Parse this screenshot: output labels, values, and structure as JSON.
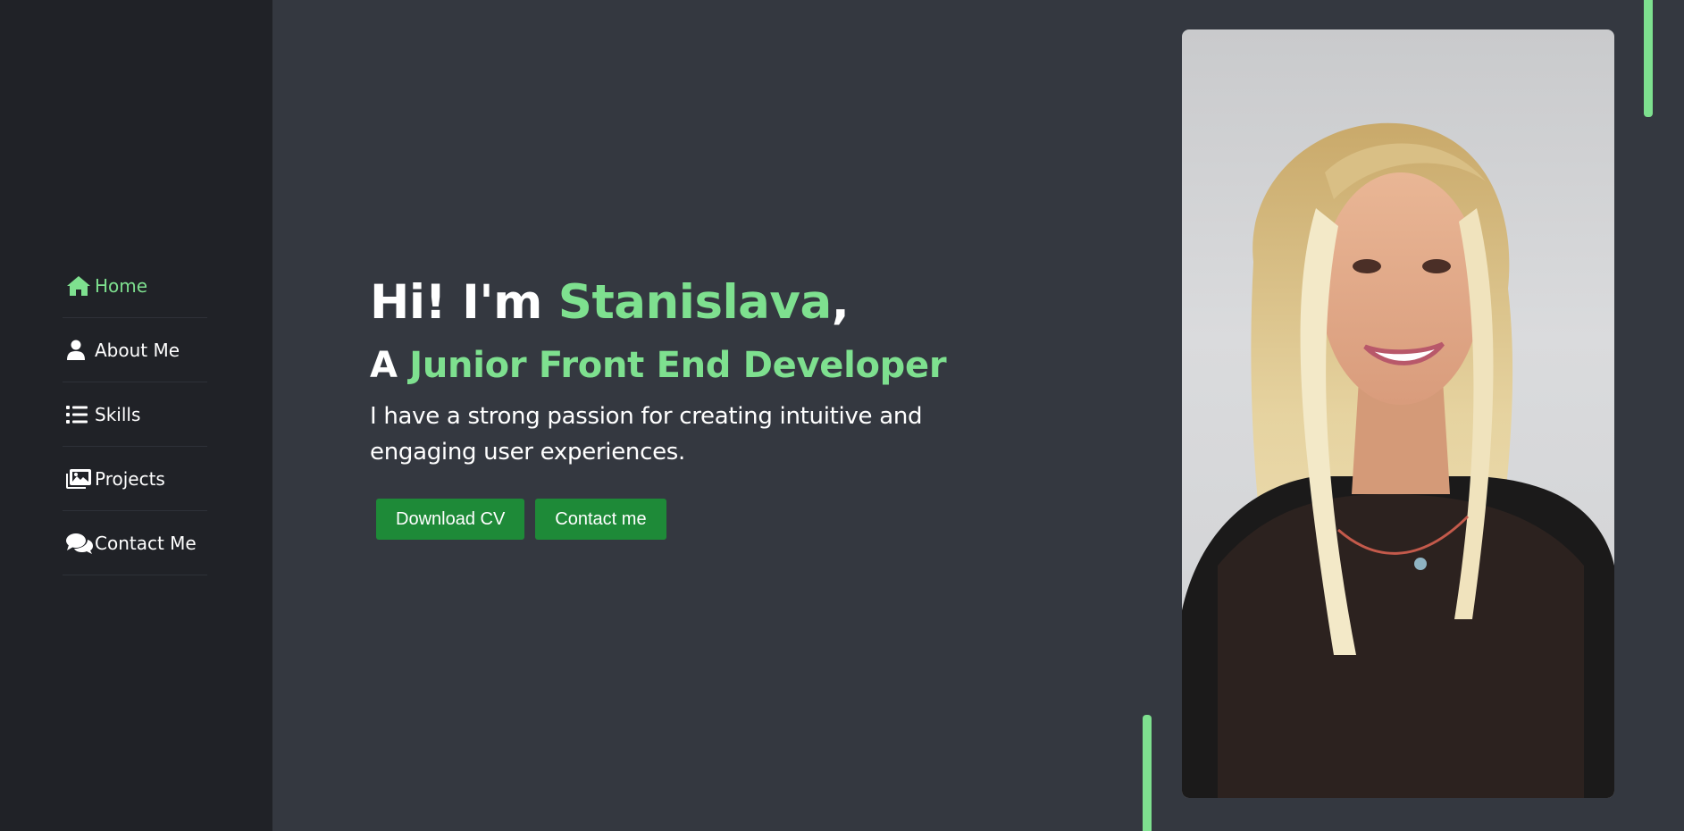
{
  "sidebar": {
    "items": [
      {
        "label": "Home",
        "icon": "home-icon",
        "active": true
      },
      {
        "label": "About Me",
        "icon": "user-icon",
        "active": false
      },
      {
        "label": "Skills",
        "icon": "list-icon",
        "active": false
      },
      {
        "label": "Projects",
        "icon": "images-icon",
        "active": false
      },
      {
        "label": "Contact Me",
        "icon": "comments-icon",
        "active": false
      }
    ]
  },
  "hero": {
    "greeting_prefix": "Hi! I'm ",
    "name": "Stanislava",
    "greeting_suffix": ",",
    "role_prefix": "A ",
    "role": "Junior Front End Developer",
    "description": "I have a strong passion for creating intuitive and engaging user experiences.",
    "download_cv_label": "Download CV",
    "contact_label": "Contact me"
  },
  "colors": {
    "accent": "#7ee08f",
    "button": "#1e8a38",
    "background": "#343840",
    "sidebar": "#202227"
  }
}
